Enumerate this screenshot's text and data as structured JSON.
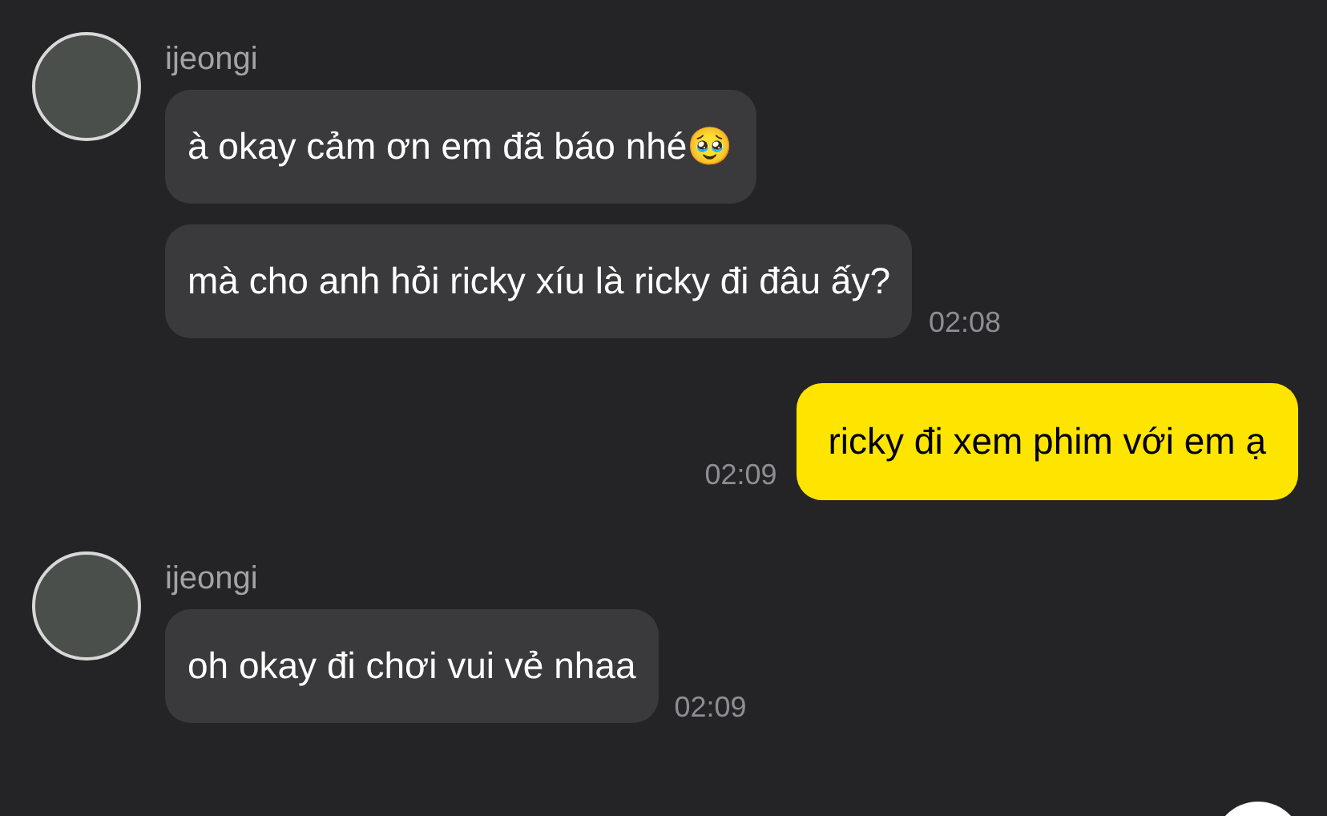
{
  "messages": [
    {
      "kind": "incoming",
      "sender": "ijeongi",
      "bubbles": [
        "à okay cảm ơn em đã báo nhé🥹",
        "mà cho anh hỏi ricky xíu là ricky đi đâu ấy?"
      ],
      "time": "02:08"
    },
    {
      "kind": "outgoing",
      "bubbles": [
        "ricky đi xem phim với em ạ"
      ],
      "time": "02:09"
    },
    {
      "kind": "incoming",
      "sender": "ijeongi",
      "bubbles": [
        "oh okay đi chơi vui vẻ nhaa"
      ],
      "time": "02:09"
    }
  ]
}
